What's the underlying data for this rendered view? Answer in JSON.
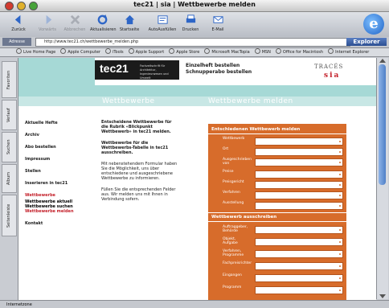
{
  "window": {
    "title": "tec21 | sia | Wettbewerbe melden"
  },
  "toolbar": {
    "buttons": [
      {
        "label": "Zurück",
        "enabled": true
      },
      {
        "label": "Vorwärts",
        "enabled": false
      },
      {
        "label": "Abbrechen",
        "enabled": false
      },
      {
        "label": "Aktualisieren",
        "enabled": true
      },
      {
        "label": "Startseite",
        "enabled": true
      },
      {
        "label": "AutoAusfüllen",
        "enabled": true
      },
      {
        "label": "Drucken",
        "enabled": true
      },
      {
        "label": "E-Mail",
        "enabled": true
      }
    ]
  },
  "address": {
    "label": "Adresse",
    "url": "http://www.tec21.ch/wettbewerbe_melden.php",
    "go_label": "Explorer"
  },
  "favorites": [
    "Live Home Page",
    "Apple Computer",
    "iTools",
    "Apple Support",
    "Apple Store",
    "Microsoft MacTopia",
    "MSN",
    "Office for Macintosh",
    "Internet Explorer"
  ],
  "sidetabs": [
    "Favoriten",
    "Verlauf",
    "Suchen",
    "Album",
    "Seitenleiste"
  ],
  "header": {
    "logo": "tec21",
    "logo_sub": "Fachzeitschrift für Architektur, Ingenieurwesen und Umwelt",
    "links": [
      "Einzelheft bestellen",
      "Schnupperabo bestellen"
    ],
    "partner_top": "TRACÉS",
    "partner_bottom": "sia"
  },
  "banner": {
    "left": "Wettbewerbe",
    "right": "Wettbewerbe melden"
  },
  "nav": {
    "items": [
      "Aktuelle Hefte",
      "Archiv",
      "Abo bestellen",
      "Impressum",
      "Stellen",
      "Inserieren in tec21",
      "Wettbewerbe",
      "Kontakt"
    ],
    "active": "Wettbewerbe",
    "sub": [
      "Wettbewerbe aktuell",
      "Wettbewerbe suchen",
      "Wettbewerbe melden"
    ]
  },
  "intro": {
    "head1": "Entscheidene Wettbewerbe für die Rubrik «Blickpunkt Wettbewerb» in tec21 melden.",
    "head2": "Wettbewerbe für die Wettbewerbs-Tabelle in tec21 ausschreiben.",
    "p1": "Mit nebenstehendem Formular haben Sie die Möglichkeit, uns über entschiedene und ausgeschriebene Wettbewerbe zu informieren.",
    "p2": "Füllen Sie die entsprechenden Felder aus. Wir melden uns mit Ihnen in Verbindung sofern."
  },
  "form": {
    "section1": "Entschiedenen Wettbewerb melden",
    "fields1": [
      "Wettbewerb",
      "Ort",
      "Ausgeschrieben von",
      "Preise",
      "Preisgericht",
      "Verfahren",
      "Ausstellung"
    ],
    "section2": "Wettbewerb ausschreiben",
    "fields2": [
      "Auftraggeber, Behörde",
      "Objekt, Aufgabe",
      "Verfahren, Programme",
      "Fachpreisrichter",
      "Eingangen",
      "Programm"
    ]
  },
  "status": {
    "text": "Internetzone"
  },
  "colors": {
    "teal": "#a6d9d6",
    "orange": "#d76c2b",
    "red": "#c4202a"
  }
}
